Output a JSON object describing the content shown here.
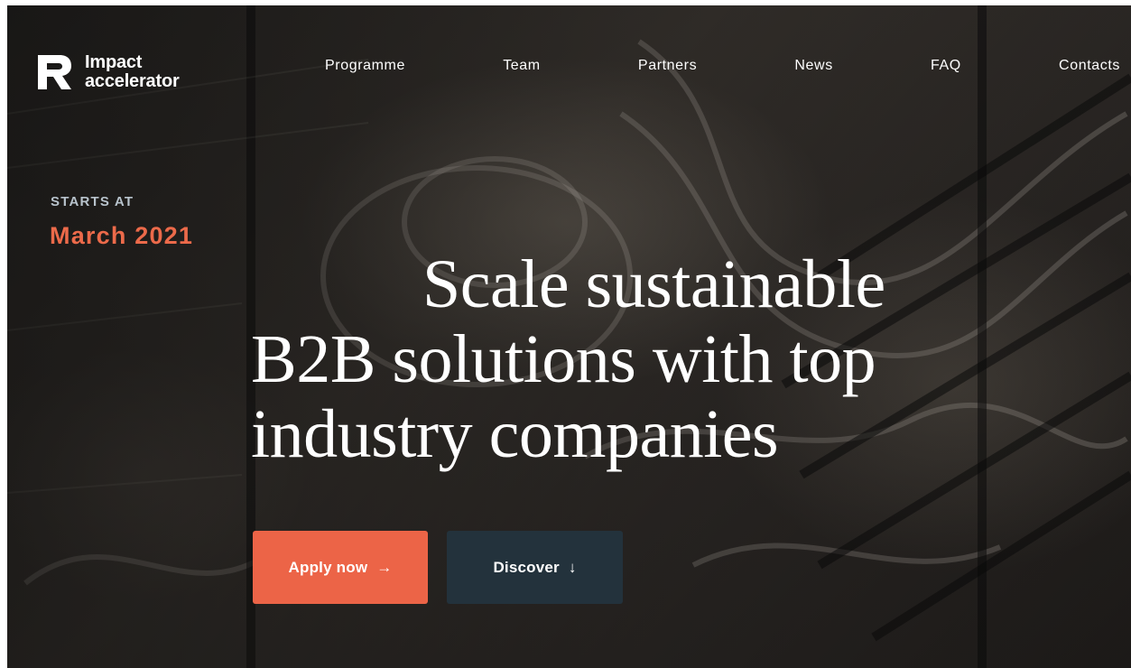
{
  "brand": {
    "name_line1": "Impact",
    "name_line2": "accelerator",
    "logo_icon": "r-logo-icon"
  },
  "nav": {
    "items": [
      {
        "label": "Programme"
      },
      {
        "label": "Team"
      },
      {
        "label": "Partners"
      },
      {
        "label": "News"
      },
      {
        "label": "FAQ"
      },
      {
        "label": "Contacts"
      }
    ]
  },
  "hero": {
    "starts_label": "STARTS AT",
    "starts_date": "March 2021",
    "headline_line1": "Scale sustainable",
    "headline_line2": "B2B solutions with top",
    "headline_line3": "industry companies"
  },
  "actions": {
    "apply_label": "Apply now",
    "apply_arrow": "→",
    "discover_label": "Discover",
    "discover_arrow": "↓"
  },
  "colors": {
    "accent": "#ec6447",
    "date": "#ec6a4a",
    "discover_bg": "#23323c"
  }
}
